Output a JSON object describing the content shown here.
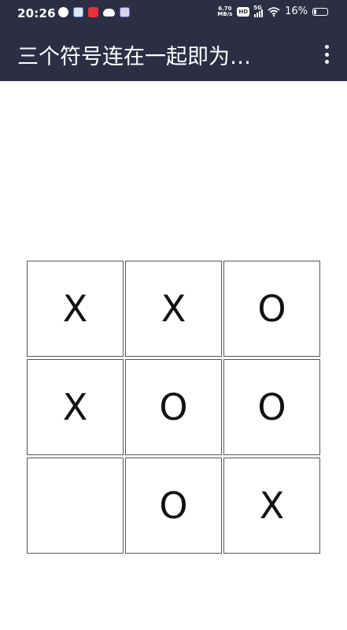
{
  "status_bar": {
    "time": "20:26",
    "net_speed_value": "6.70",
    "net_speed_unit": "MB/s",
    "hd_label": "HD",
    "network_label": "5G",
    "battery_percent": "16%",
    "battery_level": 0.16,
    "notification_icons": [
      "app-icon",
      "baidu-netdisk-icon",
      "heart-app-icon",
      "weather-icon",
      "browser-icon"
    ]
  },
  "app_bar": {
    "title": "三个符号连在一起即为…",
    "menu_icon": "more-vert-icon"
  },
  "board": {
    "cells": [
      "X",
      "X",
      "O",
      "X",
      "O",
      "O",
      "",
      "O",
      "X"
    ]
  },
  "colors": {
    "app_bar_background": "#2c2f44",
    "page_background": "#ffffff",
    "cell_border": "#555555",
    "symbol": "#111111"
  }
}
